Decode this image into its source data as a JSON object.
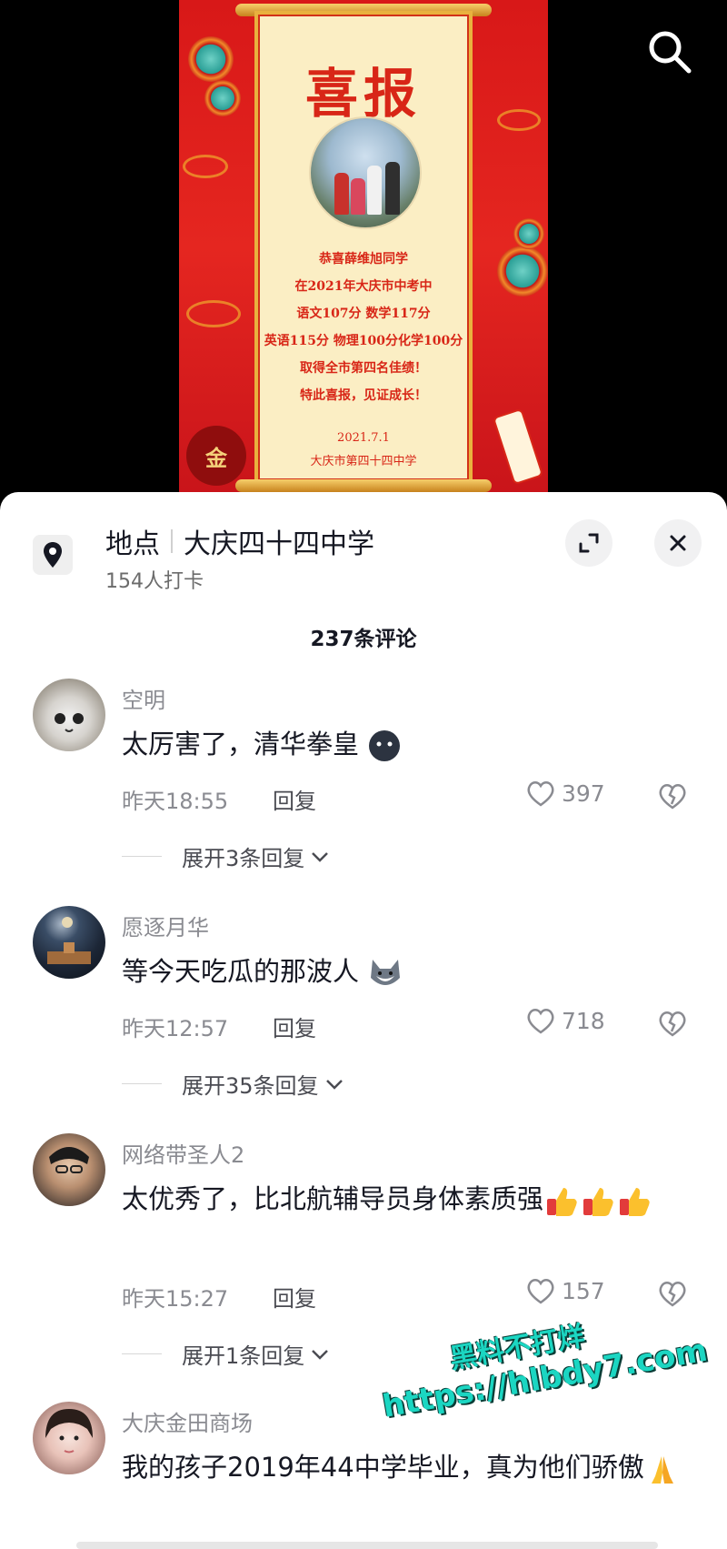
{
  "poster": {
    "title": "喜报",
    "lines": [
      "恭喜薛维旭同学",
      "在2021年大庆市中考中",
      "语文107分 数学117分",
      "英语115分 物理100分化学100分",
      "取得全市第四名佳绩！",
      "特此喜报，见证成长！"
    ],
    "date": "2021.7.1",
    "school": "大庆市第四十四中学"
  },
  "header": {
    "search_icon": "search-icon"
  },
  "location": {
    "label": "地点",
    "name": "大庆四十四中学",
    "checkins": "154人打卡",
    "pin_icon": "location-pin-icon",
    "expand_icon": "expand-icon",
    "close_icon": "close-icon"
  },
  "comments_header": {
    "count_label": "237条评论"
  },
  "comments": [
    {
      "user": "空明",
      "text": "太厉害了，清华拳皇",
      "emoji": "dark-face-emoji",
      "time": "昨天18:55",
      "reply": "回复",
      "likes": "397",
      "expand": "展开3条回复"
    },
    {
      "user": "愿逐月华",
      "text": "等今天吃瓜的那波人",
      "emoji": "husky-emoji",
      "time": "昨天12:57",
      "reply": "回复",
      "likes": "718",
      "expand": "展开35条回复"
    },
    {
      "user": "网络带圣人2",
      "text": "太优秀了，比北航辅导员身体素质强",
      "emoji": "thumbs-up-emoji",
      "time": "昨天15:27",
      "reply": "回复",
      "likes": "157",
      "expand": "展开1条回复"
    },
    {
      "user": "大庆金田商场",
      "text": "我的孩子2019年44中学毕业，真为他们骄傲",
      "emoji": "pray-emoji"
    }
  ],
  "watermark": {
    "line1": "黑料不打烊",
    "line2": "https://hlbdy7.com"
  },
  "colors": {
    "poster_red": "#e52620",
    "paper": "#fbeec4",
    "text_primary": "#161823",
    "text_secondary": "#8a8b91",
    "watermark": "#1bd6c2"
  }
}
